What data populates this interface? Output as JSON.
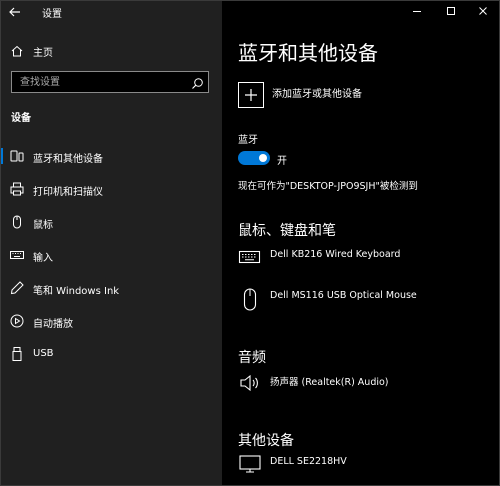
{
  "window": {
    "app_title": "设置"
  },
  "sidebar": {
    "home_label": "主页",
    "search_placeholder": "查找设置",
    "section_label": "设备",
    "items": [
      {
        "label": "蓝牙和其他设备",
        "icon": "bluetooth-devices-icon",
        "active": true
      },
      {
        "label": "打印机和扫描仪",
        "icon": "printer-icon",
        "active": false
      },
      {
        "label": "鼠标",
        "icon": "mouse-icon",
        "active": false
      },
      {
        "label": "输入",
        "icon": "keyboard-icon",
        "active": false
      },
      {
        "label": "笔和 Windows Ink",
        "icon": "pen-icon",
        "active": false
      },
      {
        "label": "自动播放",
        "icon": "autoplay-icon",
        "active": false
      },
      {
        "label": "USB",
        "icon": "usb-icon",
        "active": false
      }
    ]
  },
  "main": {
    "page_title": "蓝牙和其他设备",
    "add_device_label": "添加蓝牙或其他设备",
    "bluetooth": {
      "label": "蓝牙",
      "toggle_state": "开",
      "discoverable_text": "现在可作为\"DESKTOP-JPO9SJH\"被检测到"
    },
    "sections": {
      "input_title": "鼠标、键盘和笔",
      "audio_title": "音频",
      "other_title": "其他设备"
    },
    "devices": {
      "keyboard": "Dell KB216 Wired Keyboard",
      "mouse": "Dell MS116 USB Optical Mouse",
      "speaker": "扬声器 (Realtek(R) Audio)",
      "monitor": "DELL SE2218HV"
    }
  },
  "colors": {
    "accent": "#0078d7",
    "sidebar_bg": "#202020",
    "main_bg": "#000000"
  }
}
